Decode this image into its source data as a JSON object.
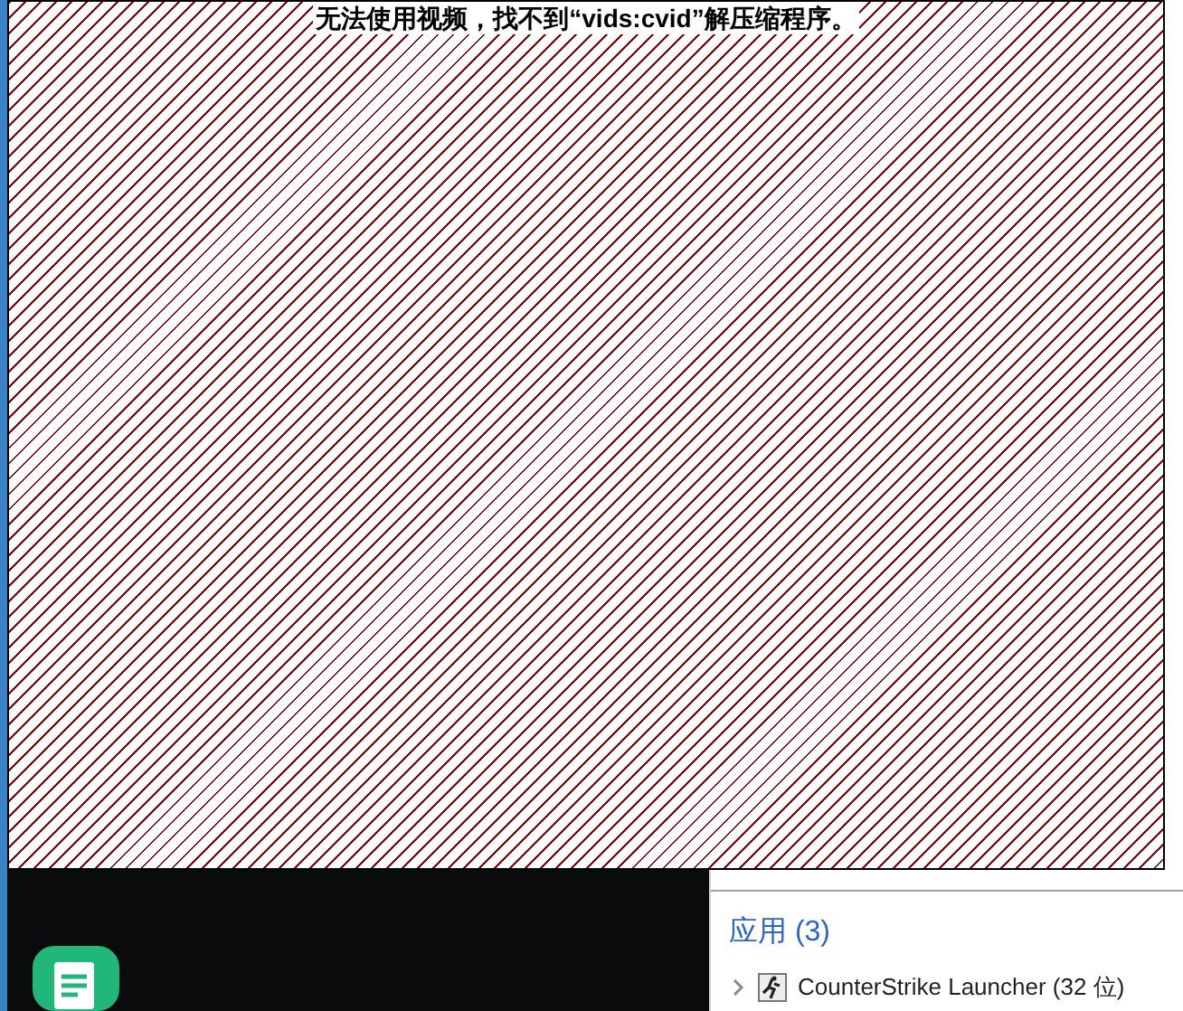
{
  "message": "无法使用视频，找不到“vids:cvid”解压缩程序。",
  "section": {
    "title": "应用 (3)"
  },
  "apps": [
    {
      "name": "CounterStrike Launcher (32 位)",
      "expanded": false
    }
  ]
}
